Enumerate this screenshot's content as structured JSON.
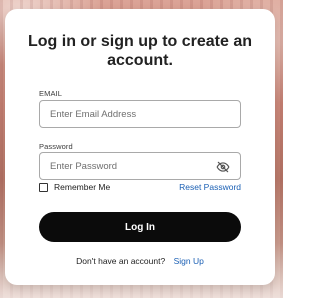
{
  "modal": {
    "title": "Log in or sign up to create an account.",
    "email": {
      "label": "EMAIL",
      "placeholder": "Enter Email Address",
      "value": ""
    },
    "password": {
      "label": "Password",
      "placeholder": "Enter Password",
      "value": "",
      "visibility_icon": "eye-off-icon"
    },
    "remember_me": {
      "label": "Remember Me",
      "checked": false
    },
    "reset_password": {
      "label": "Reset Password"
    },
    "login_button": {
      "label": "Log In"
    },
    "signup_prompt": {
      "text": "Don't have an account?",
      "link": "Sign Up"
    }
  },
  "colors": {
    "primary_button": "#0b0b0b",
    "link": "#1a5fb4"
  }
}
